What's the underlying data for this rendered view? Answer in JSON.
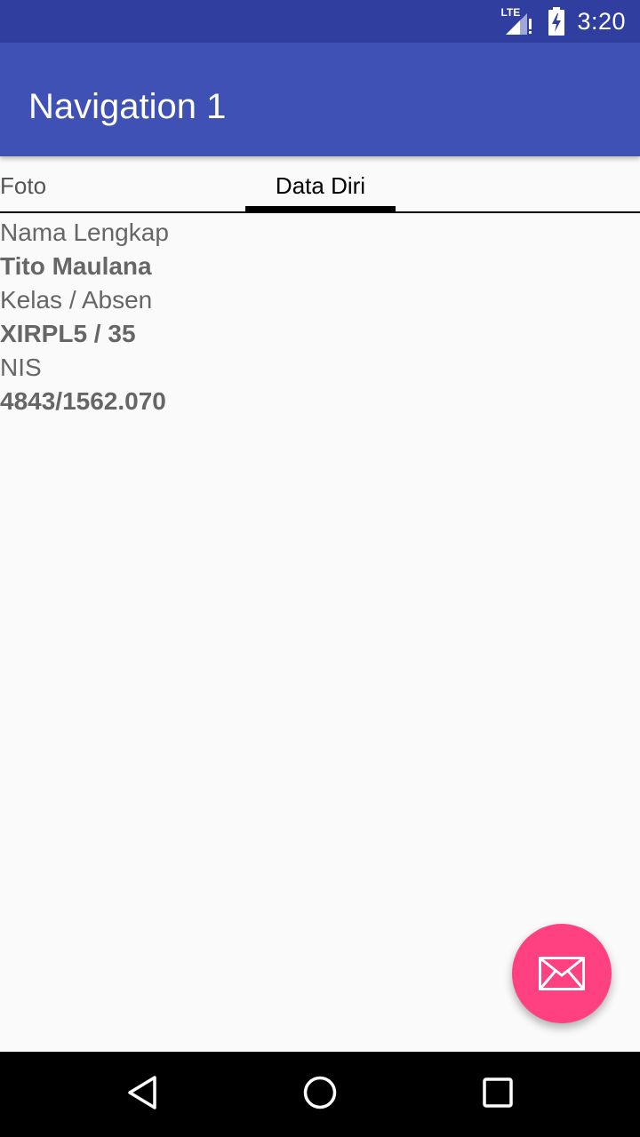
{
  "status_bar": {
    "time": "3:20",
    "network_label": "LTE",
    "icons": [
      "lte-signal-icon",
      "battery-charging-icon"
    ]
  },
  "app_bar": {
    "title": "Navigation 1"
  },
  "tabs": [
    {
      "label": "Foto",
      "selected": false
    },
    {
      "label": "Data Diri",
      "selected": true
    }
  ],
  "profile": {
    "fields": [
      {
        "label": "Nama Lengkap",
        "value": "Tito Maulana"
      },
      {
        "label": "Kelas / Absen",
        "value": "XIRPL5 / 35"
      },
      {
        "label": "NIS",
        "value": "4843/1562.070"
      }
    ]
  },
  "fab": {
    "icon": "mail-icon",
    "color": "#ff4081"
  },
  "nav_bar": {
    "icons": [
      "back-icon",
      "home-icon",
      "recents-icon"
    ]
  },
  "colors": {
    "primary": "#3f51b5",
    "primary_dark": "#303f9f",
    "accent": "#ff4081"
  }
}
